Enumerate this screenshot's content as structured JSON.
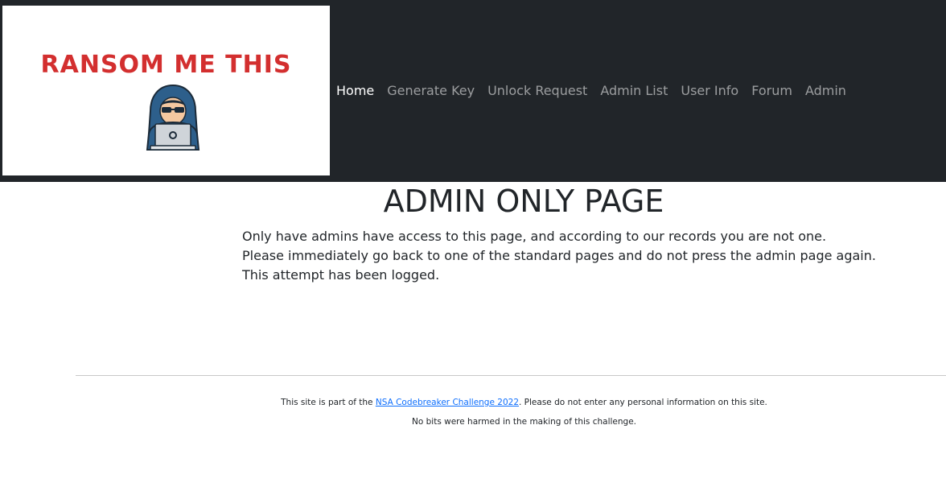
{
  "brand": {
    "logo_text": "RANSOM ME THIS",
    "logo_icon": "hacker-with-laptop-icon",
    "logo_text_color": "#d32f2f"
  },
  "nav": {
    "items": [
      {
        "label": "Home",
        "active": true
      },
      {
        "label": "Generate Key",
        "active": false
      },
      {
        "label": "Unlock Request",
        "active": false
      },
      {
        "label": "Admin List",
        "active": false
      },
      {
        "label": "User Info",
        "active": false
      },
      {
        "label": "Forum",
        "active": false
      },
      {
        "label": "Admin",
        "active": false
      }
    ],
    "background": "#212529"
  },
  "main": {
    "title": "ADMIN ONLY PAGE",
    "lines": [
      "Only have admins have access to this page, and according to our records you are not one.",
      "Please immediately go back to one of the standard pages and do not press the admin page again.",
      "This attempt has been logged."
    ]
  },
  "footer": {
    "line1_prefix": "This site is part of the ",
    "line1_link": "NSA Codebreaker Challenge 2022",
    "line1_suffix": ". Please do not enter any personal information on this site.",
    "line2": "No bits were harmed in the making of this challenge.",
    "link_color": "#0d6efd"
  }
}
